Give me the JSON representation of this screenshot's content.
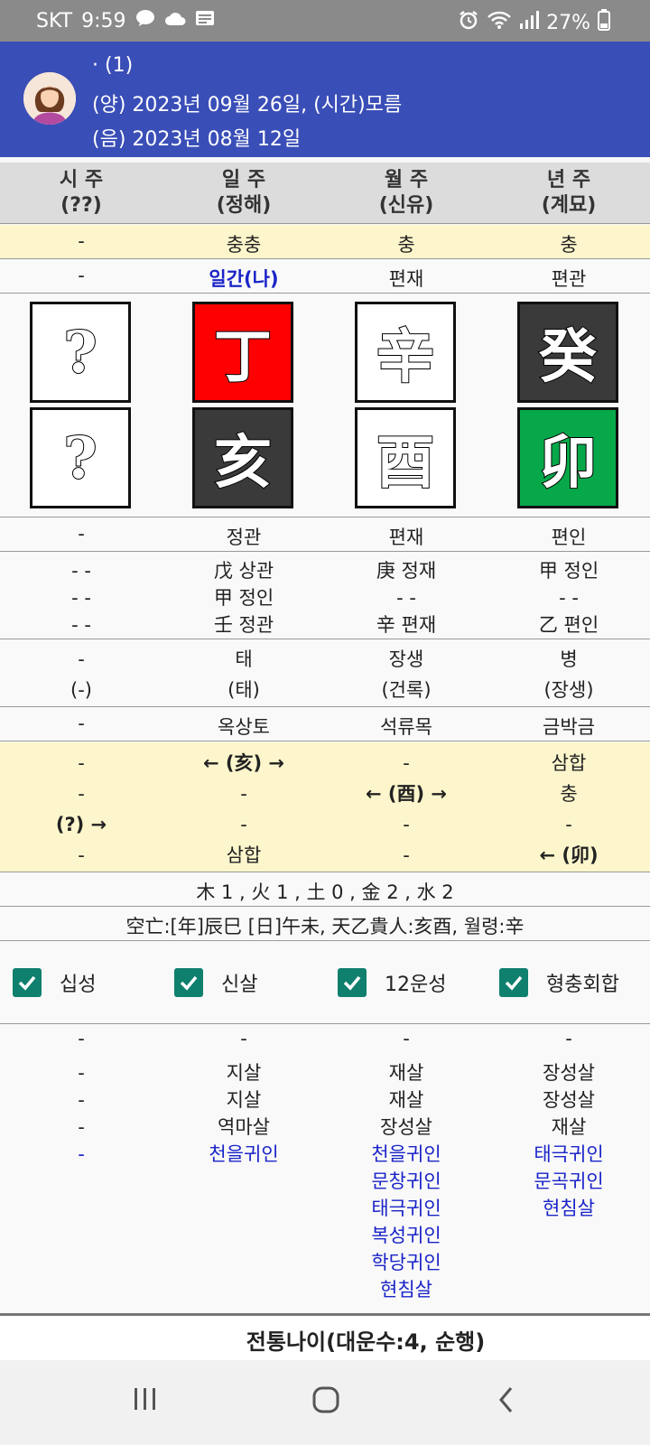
{
  "status": {
    "carrier": "SKT",
    "time": "9:59",
    "battery": "27%",
    "icons": [
      "talk-icon",
      "cloud-icon",
      "news-icon",
      "alarm-icon",
      "wifi-icon",
      "signal-icon",
      "battery-icon"
    ]
  },
  "header": {
    "name": "· (1)",
    "solar": "(양) 2023년 09월 26일, (시간)모름",
    "lunar": "(음) 2023년 08월 12일"
  },
  "columns": [
    {
      "title": "시 주",
      "sub": "(??)"
    },
    {
      "title": "일 주",
      "sub": "(정해)"
    },
    {
      "title": "월 주",
      "sub": "(신유)"
    },
    {
      "title": "년 주",
      "sub": "(계묘)"
    }
  ],
  "rows": {
    "clash_top": [
      "-",
      "충충",
      "충",
      "충"
    ],
    "ten_gods_top": [
      "-",
      "일간(나)",
      "편재",
      "편관"
    ],
    "stems": [
      {
        "char": "?",
        "color": "white"
      },
      {
        "char": "丁",
        "color": "red"
      },
      {
        "char": "辛",
        "color": "white"
      },
      {
        "char": "癸",
        "color": "dark"
      }
    ],
    "branches": [
      {
        "char": "?",
        "color": "white"
      },
      {
        "char": "亥",
        "color": "dark"
      },
      {
        "char": "酉",
        "color": "white"
      },
      {
        "char": "卯",
        "color": "green"
      }
    ],
    "ten_gods_bottom": [
      "-",
      "정관",
      "편재",
      "편인"
    ],
    "hidden": [
      [
        "- -",
        "- -",
        "- -"
      ],
      [
        "戊 상관",
        "甲 정인",
        "壬 정관"
      ],
      [
        "庚 정재",
        "- -",
        "辛 편재"
      ],
      [
        "甲 정인",
        "- -",
        "乙 편인"
      ]
    ],
    "stage": [
      [
        "-",
        "(-)"
      ],
      [
        "태",
        "(태)"
      ],
      [
        "장생",
        "(건록)"
      ],
      [
        "병",
        "(장생)"
      ]
    ],
    "napeum": [
      "-",
      "옥상토",
      "석류목",
      "금박금"
    ],
    "relations": [
      [
        "-",
        "← (亥) →",
        "-",
        "삼합"
      ],
      [
        "-",
        "-",
        "← (酉) →",
        "충"
      ],
      [
        "(?) →",
        "-",
        "-",
        "-"
      ],
      [
        "-",
        "삼합",
        "-",
        "← (卯)"
      ]
    ],
    "elements": "木 1 , 火 1 , 土 0 , 金 2 , 水 2",
    "void": "空亡:[年]辰巳 [日]午未, 天乙貴人:亥酉, 월령:辛"
  },
  "checkboxes": [
    {
      "label": "십성",
      "checked": true
    },
    {
      "label": "신살",
      "checked": true
    },
    {
      "label": "12운성",
      "checked": true
    },
    {
      "label": "형충회합",
      "checked": true
    }
  ],
  "sinsal": {
    "dash_row": [
      "-",
      "-",
      "-",
      "-"
    ],
    "black": [
      [
        "-",
        "-",
        "-"
      ],
      [
        "지살",
        "지살",
        "역마살"
      ],
      [
        "재살",
        "재살",
        "장성살"
      ],
      [
        "장성살",
        "장성살",
        "재살"
      ]
    ],
    "blue": [
      [
        "-"
      ],
      [
        "천을귀인"
      ],
      [
        "천을귀인",
        "문창귀인",
        "태극귀인",
        "복성귀인",
        "학당귀인",
        "현침살"
      ],
      [
        "태극귀인",
        "문곡귀인",
        "현침살"
      ]
    ]
  },
  "footer": {
    "label": "전통나이(대운수:4, 순행)"
  },
  "colors": {
    "header_bg": "#3a4eb7",
    "yellow_row": "#fdf6cc",
    "checkbox": "#0f7f6e",
    "blue_text": "#1a24c8"
  }
}
